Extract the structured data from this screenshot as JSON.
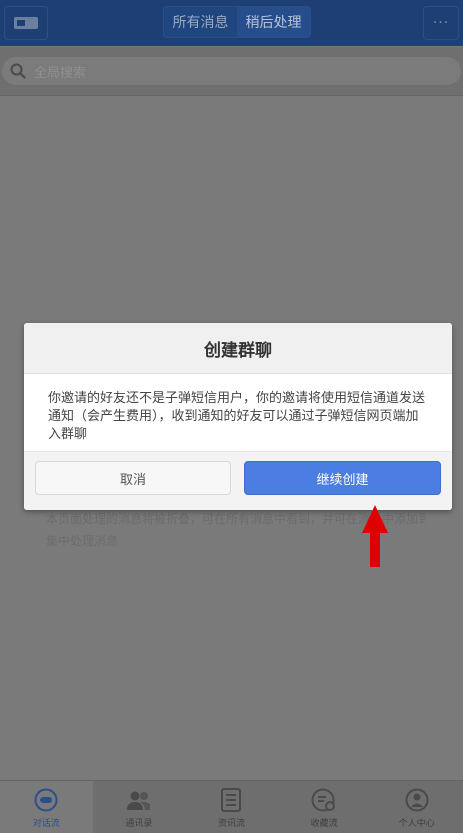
{
  "header": {
    "tabs": [
      {
        "label": "所有消息",
        "active": false
      },
      {
        "label": "稍后处理",
        "active": true
      }
    ],
    "more_label": "···"
  },
  "search": {
    "placeholder": "全局搜索"
  },
  "background_hint": {
    "line1": "本页面处理的消息将被折叠，可在所有消息中看到，并可在消息中添加到稍后处理，方便",
    "line2": "集中处理消息"
  },
  "dialog": {
    "title": "创建群聊",
    "message": "你邀请的好友还不是子弹短信用户，你的邀请将使用短信通道发送通知（会产生费用），收到通知的好友可以通过子弹短信网页端加入群聊",
    "cancel_label": "取消",
    "confirm_label": "继续创建"
  },
  "tabbar": {
    "items": [
      {
        "label": "对话流",
        "icon": "chat-bubble-icon",
        "active": true
      },
      {
        "label": "通讯录",
        "icon": "contacts-icon",
        "active": false
      },
      {
        "label": "资讯流",
        "icon": "news-icon",
        "active": false
      },
      {
        "label": "收藏流",
        "icon": "favorites-icon",
        "active": false
      },
      {
        "label": "个人中心",
        "icon": "profile-icon",
        "active": false
      }
    ]
  },
  "colors": {
    "header_bg": "#1e3f73",
    "primary_button": "#4b7de2",
    "arrow": "#e00000"
  }
}
